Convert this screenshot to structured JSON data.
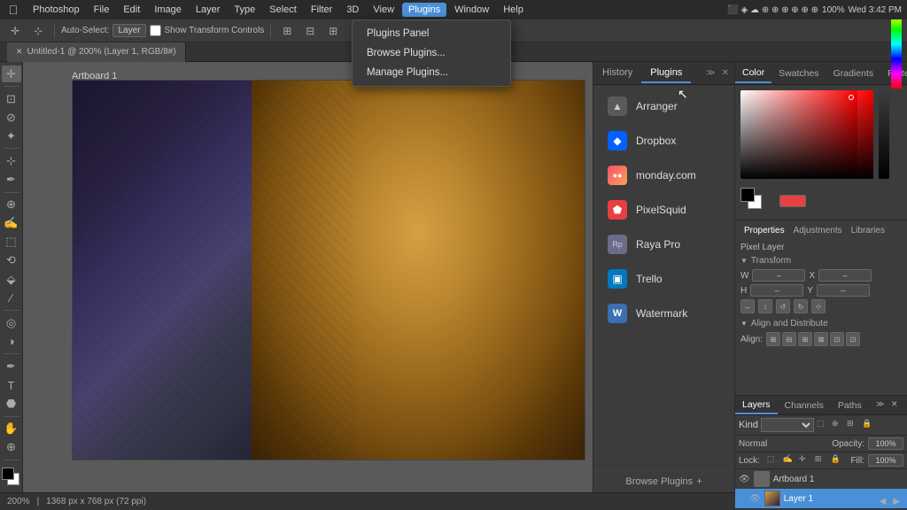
{
  "menubar": {
    "app_name": "Photoshop",
    "menus": [
      "File",
      "Edit",
      "Image",
      "Layer",
      "Type",
      "Select",
      "Filter",
      "3D",
      "View",
      "Plugins",
      "Window",
      "Help"
    ],
    "active_menu": "Plugins",
    "right_info": "Wed 3:42 PM"
  },
  "plugins_dropdown": {
    "items": [
      "Plugins Panel",
      "Browse Plugins...",
      "Manage Plugins..."
    ]
  },
  "options_bar": {
    "auto_select_label": "Auto-Select:",
    "layer_label": "Layer",
    "transform_label": "Show Transform Controls"
  },
  "tab_bar": {
    "tab_label": "Untitled-1 @ 200% (Layer 1, RGB/8#)"
  },
  "toolbar_tools": [
    "▶",
    "⊹",
    "✂",
    "⊡",
    "◎",
    "⊘",
    "✒",
    "✍",
    "⬚",
    "⟲",
    "∕",
    "⬙",
    "T",
    "◧",
    "⬣",
    "⋯"
  ],
  "plugins_panel": {
    "tabs": [
      "History",
      "Plugins"
    ],
    "active_tab": "Plugins",
    "plugins": [
      {
        "name": "Arranger",
        "icon": "▲",
        "icon_bg": "#5a5a5a"
      },
      {
        "name": "Dropbox",
        "icon": "◆",
        "icon_bg": "#0061ff"
      },
      {
        "name": "monday.com",
        "icon": "◉",
        "icon_bg": "#f94f6e"
      },
      {
        "name": "PixelSquid",
        "icon": "⬟",
        "icon_bg": "#e84040"
      },
      {
        "name": "Raya Pro",
        "icon": "◈",
        "icon_bg": "#6b6b8a"
      },
      {
        "name": "Trello",
        "icon": "▣",
        "icon_bg": "#0079bf"
      },
      {
        "name": "Watermark",
        "icon": "W",
        "icon_bg": "#3a6fb0"
      }
    ],
    "browse_label": "Browse Plugins"
  },
  "right_panel": {
    "tabs": [
      "Color",
      "Swatches",
      "Gradients",
      "Patterns"
    ],
    "active_tab": "Color"
  },
  "properties": {
    "tabs": [
      "Properties",
      "Adjustments",
      "Libraries"
    ],
    "active_tab": "Properties",
    "pixel_layer_label": "Pixel Layer",
    "transform_label": "Transform",
    "align_distribute_label": "Align and Distribute",
    "align_label": "Align:"
  },
  "layers_panel": {
    "tabs": [
      "Layers",
      "Channels",
      "Paths"
    ],
    "active_tab": "Layers",
    "kind_label": "Kind",
    "opacity_label": "Opacity:",
    "opacity_value": "100%",
    "normal_label": "Normal",
    "fill_label": "Fill:",
    "fill_value": "100%",
    "lock_label": "Lock:",
    "artboard_label": "Artboard 1",
    "layer_label": "Layer 1"
  },
  "status_bar": {
    "zoom": "200%",
    "dimensions": "1368 px x 768 px (72 ppi)"
  },
  "artboard": {
    "label": "Artboard 1"
  }
}
